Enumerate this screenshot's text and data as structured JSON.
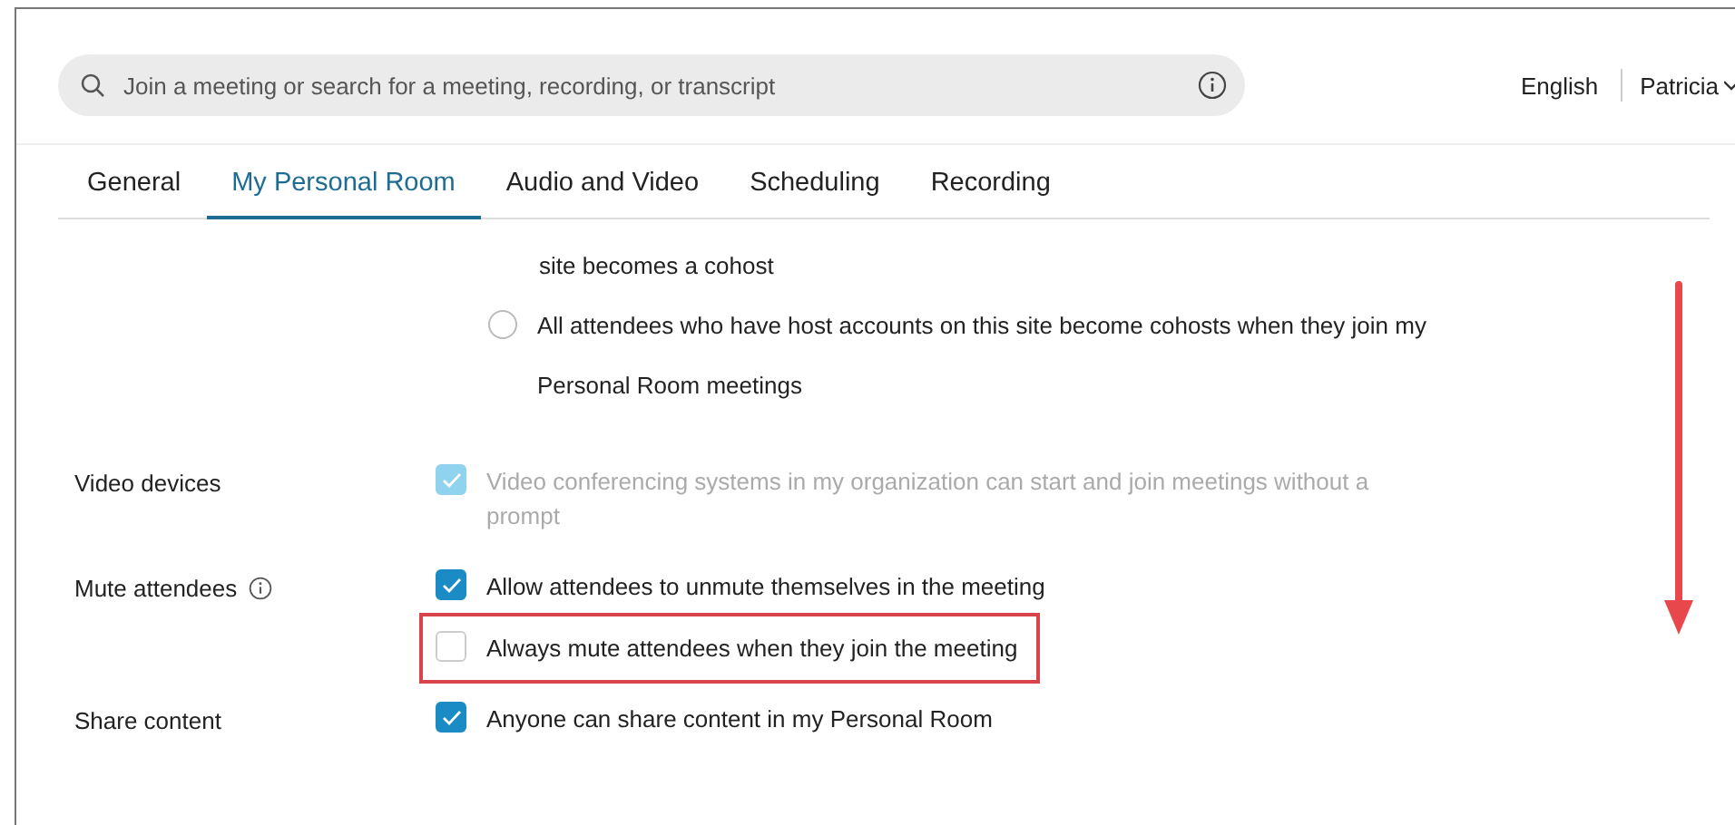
{
  "search": {
    "placeholder": "Join a meeting or search for a meeting, recording, or transcript"
  },
  "header": {
    "language": "English",
    "user": "Patricia"
  },
  "tabs": [
    {
      "label": "General",
      "selected": false
    },
    {
      "label": "My Personal Room",
      "selected": true
    },
    {
      "label": "Audio and Video",
      "selected": false
    },
    {
      "label": "Scheduling",
      "selected": false
    },
    {
      "label": "Recording",
      "selected": false
    }
  ],
  "cohost_options": {
    "continuation": "site becomes a cohost",
    "radio": {
      "label": "All attendees who have host accounts on this site become cohosts when they join my Personal Room meetings",
      "selected": false
    }
  },
  "settings": [
    {
      "label": "Video devices",
      "info": false,
      "options": [
        {
          "label": "Video conferencing systems in my organization can start and join meetings without a prompt",
          "checked": true,
          "disabled": true,
          "highlighted": false
        }
      ]
    },
    {
      "label": "Mute attendees",
      "info": true,
      "options": [
        {
          "label": "Allow attendees to unmute themselves in the meeting",
          "checked": true,
          "disabled": false,
          "highlighted": false
        },
        {
          "label": "Always mute attendees when they join the meeting",
          "checked": false,
          "disabled": false,
          "highlighted": true
        }
      ]
    },
    {
      "label": "Share content",
      "info": false,
      "options": [
        {
          "label": "Anyone can share content in my Personal Room",
          "checked": true,
          "disabled": false,
          "highlighted": false
        }
      ]
    }
  ]
}
